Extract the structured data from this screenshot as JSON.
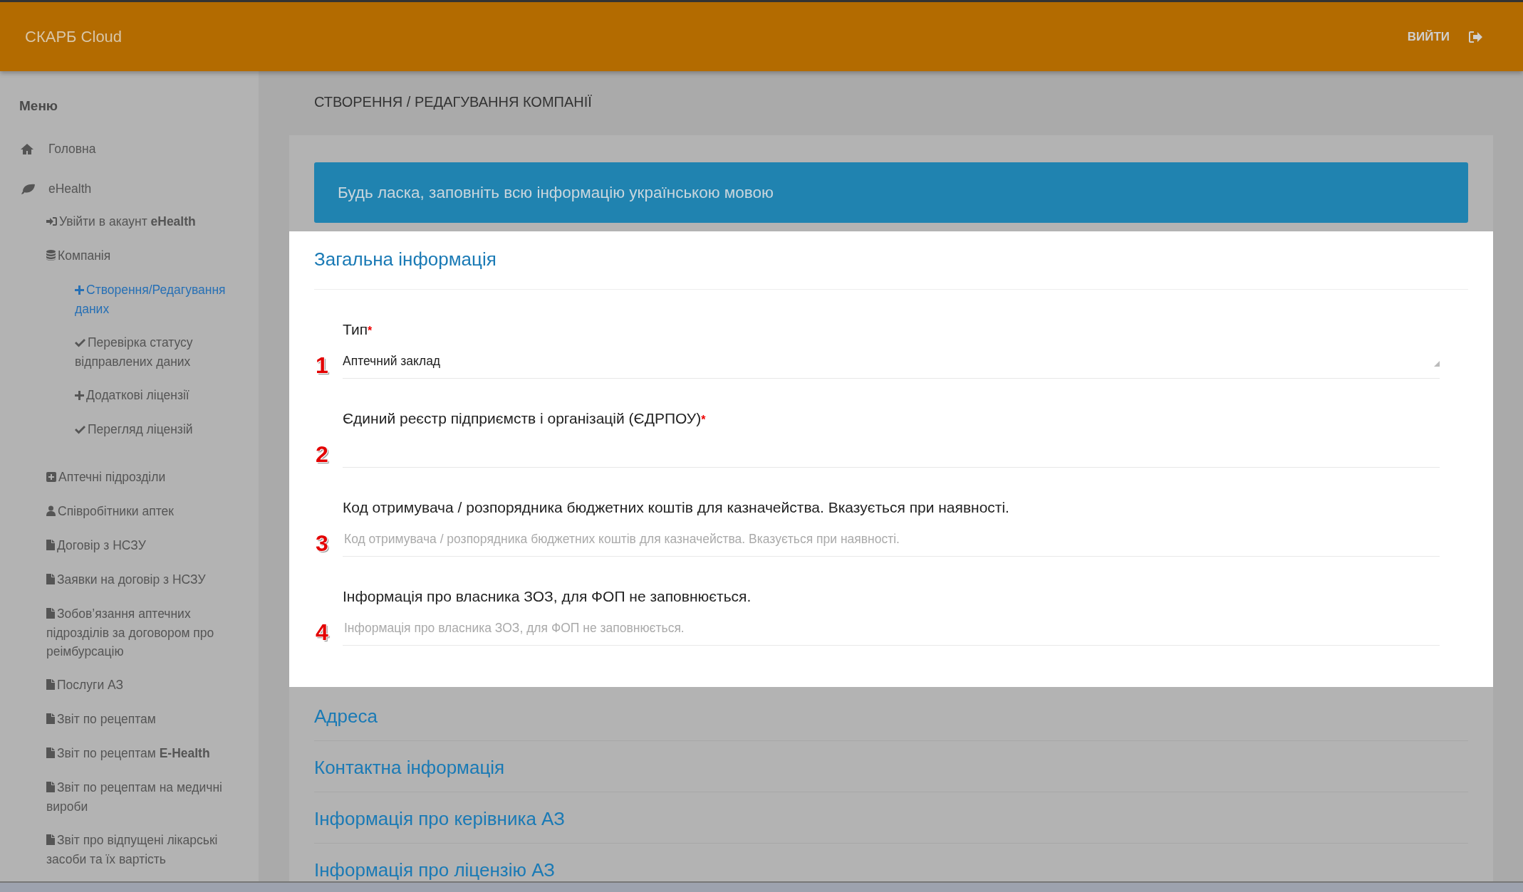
{
  "header": {
    "brand": "СКАРБ Cloud",
    "logout": "ВИЙТИ"
  },
  "sidebar": {
    "title": "Меню",
    "items": [
      {
        "kind": "home",
        "label": "Головна",
        "selected": false
      },
      {
        "kind": "leaf",
        "label": "eHealth",
        "selected": false,
        "children": [
          {
            "kind": "login",
            "label": "Увійти в акаунт **eHealth**",
            "selected": false
          },
          {
            "kind": "database",
            "label": "Компанія",
            "selected": false,
            "children": [
              {
                "kind": "plus",
                "label": "Створення/Редагування даних",
                "selected": true
              },
              {
                "kind": "check",
                "label": "Перевірка статусу відправлених даних",
                "selected": false
              },
              {
                "kind": "plus",
                "label": "Додаткові ліцензії",
                "selected": false
              },
              {
                "kind": "check",
                "label": "Перегляд ліцензій",
                "selected": false
              }
            ]
          },
          {
            "kind": "plus-square",
            "label": "Аптечні підрозділи",
            "selected": false
          },
          {
            "kind": "user",
            "label": "Співробітники аптек",
            "selected": false
          },
          {
            "kind": "file",
            "label": "Договір з НСЗУ",
            "selected": false
          },
          {
            "kind": "file",
            "label": "Заявки на договір з НСЗУ",
            "selected": false
          },
          {
            "kind": "file",
            "label": "Зобов’язання аптечних підрозділів за договором про реімбурсацію",
            "selected": false
          },
          {
            "kind": "file",
            "label": "Послуги АЗ",
            "selected": false
          },
          {
            "kind": "file",
            "label": "Звіт по рецептам",
            "selected": false
          },
          {
            "kind": "file",
            "label": "Звіт по рецептам **E-Health**",
            "selected": false
          },
          {
            "kind": "file",
            "label": "Звіт по рецептам на медичні вироби",
            "selected": false
          },
          {
            "kind": "file",
            "label": "Звіт про відпущені лікарські засоби та їх вартість",
            "selected": false
          }
        ]
      }
    ]
  },
  "page_title": "СТВОРЕННЯ / РЕДАГУВАННЯ КОМПАНІЇ",
  "alert": "Будь ласка, заповніть всю інформацію українською мовою",
  "required_mark": "*",
  "sections": [
    {
      "title": "Загальна інформація",
      "expanded": true,
      "fields": [
        {
          "kind": "select",
          "marker": "1",
          "label": "Тип",
          "required": true,
          "value": "Аптечний заклад"
        },
        {
          "kind": "text",
          "marker": "2",
          "label": "Єдиний реєстр підприємств і організацій (ЄДРПОУ)",
          "required": true
        },
        {
          "kind": "text",
          "marker": "3",
          "label": "Код отримувача / розпорядника бюджетних коштів для казначейства. Вказується при наявності.",
          "required": false,
          "placeholder": "Код отримувача / розпорядника бюджетних коштів для казначейства. Вказується при наявності."
        },
        {
          "kind": "text",
          "marker": "4",
          "label": "Інформація про власника ЗОЗ, для ФОП не заповнюється.",
          "required": false,
          "placeholder": "Інформація про власника ЗОЗ, для ФОП не заповнюється."
        }
      ]
    },
    {
      "title": "Адреса",
      "expanded": false
    },
    {
      "title": "Контактна інформація",
      "expanded": false
    },
    {
      "title": "Інформація про керівника АЗ",
      "expanded": false
    },
    {
      "title": "Інформація про ліцензію АЗ",
      "expanded": false
    }
  ]
}
